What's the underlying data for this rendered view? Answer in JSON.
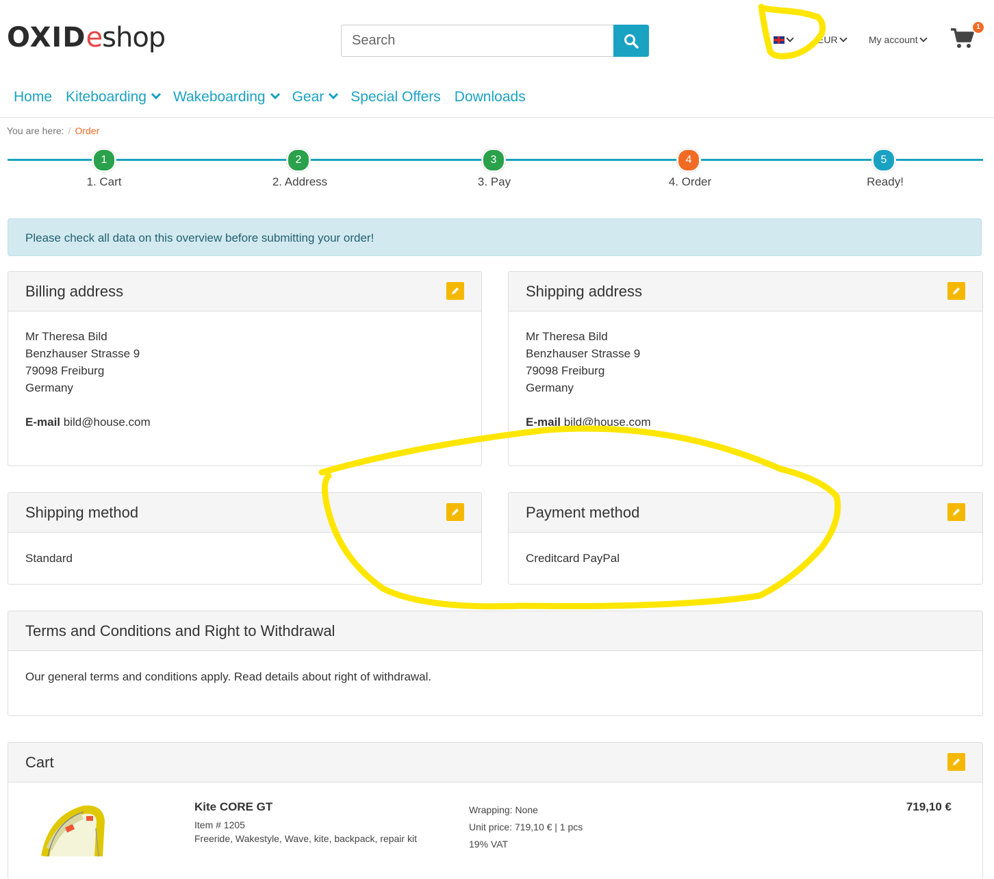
{
  "header": {
    "logo": {
      "part1": "OXID",
      "part2": "e",
      "part3": "shop"
    },
    "search": {
      "placeholder": "Search"
    },
    "currency": "EUR",
    "account": "My account",
    "cart_count": "1"
  },
  "nav": {
    "items": [
      {
        "label": "Home"
      },
      {
        "label": "Kiteboarding"
      },
      {
        "label": "Wakeboarding"
      },
      {
        "label": "Gear"
      },
      {
        "label": "Special Offers"
      },
      {
        "label": "Downloads"
      }
    ]
  },
  "breadcrumb": {
    "prefix": "You are here:",
    "separator": "/",
    "current": "Order"
  },
  "steps": [
    {
      "num": "1",
      "label": "1. Cart",
      "color": "#2aa14a"
    },
    {
      "num": "2",
      "label": "2. Address",
      "color": "#2aa14a"
    },
    {
      "num": "3",
      "label": "3. Pay",
      "color": "#2aa14a"
    },
    {
      "num": "4",
      "label": "4. Order",
      "color": "#f26b24"
    },
    {
      "num": "5",
      "label": "Ready!",
      "color": "#1aa2c2"
    }
  ],
  "alert": "Please check all data on this overview before submitting your order!",
  "billing": {
    "title": "Billing address",
    "name": "Mr Theresa Bild",
    "street": "Benzhauser Strasse 9",
    "city": "79098 Freiburg",
    "country": "Germany",
    "email_label": "E-mail",
    "email": "bild@house.com"
  },
  "shipping_address": {
    "title": "Shipping address",
    "name": "Mr Theresa Bild",
    "street": "Benzhauser Strasse 9",
    "city": "79098 Freiburg",
    "country": "Germany",
    "email_label": "E-mail",
    "email": "bild@house.com"
  },
  "shipping_method": {
    "title": "Shipping method",
    "value": "Standard"
  },
  "payment_method": {
    "title": "Payment method",
    "value": "Creditcard PayPal"
  },
  "terms": {
    "title": "Terms and Conditions and Right to Withdrawal",
    "text": "Our general terms and conditions apply.  Read details about right of withdrawal."
  },
  "cart": {
    "title": "Cart",
    "item": {
      "title": "Kite CORE GT",
      "number": "Item # 1205",
      "tags": "Freeride, Wakestyle, Wave, kite, backpack, repair kit",
      "wrapping": "Wrapping: None",
      "unit_price": "Unit price: 719,10 € | 1 pcs",
      "vat": "19% VAT",
      "price": "719,10 €"
    }
  },
  "colors": {
    "accent": "#1aa2c2",
    "edit": "#f5b800",
    "annotation": "#ffe600"
  }
}
